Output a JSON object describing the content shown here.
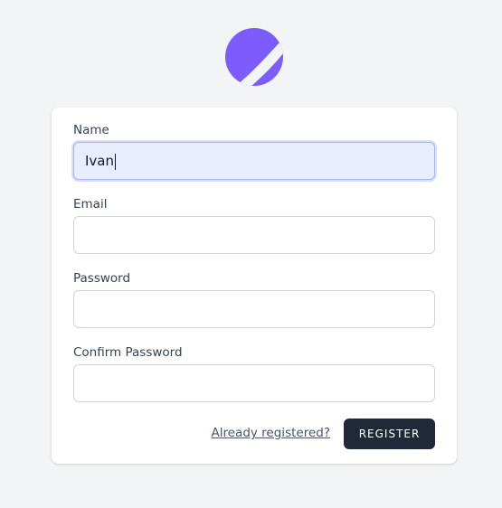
{
  "logo": {
    "icon": "planet-logo-icon",
    "color": "#7c5cfc"
  },
  "form": {
    "name": {
      "label": "Name",
      "value": "Ivan"
    },
    "email": {
      "label": "Email",
      "value": ""
    },
    "password": {
      "label": "Password",
      "value": ""
    },
    "confirm_password": {
      "label": "Confirm Password",
      "value": ""
    }
  },
  "actions": {
    "login_link": "Already registered?",
    "register_button": "REGISTER"
  },
  "colors": {
    "background": "#f3f4f6",
    "card": "#ffffff",
    "button": "#1f2937",
    "focused_input": "#e8edff"
  }
}
